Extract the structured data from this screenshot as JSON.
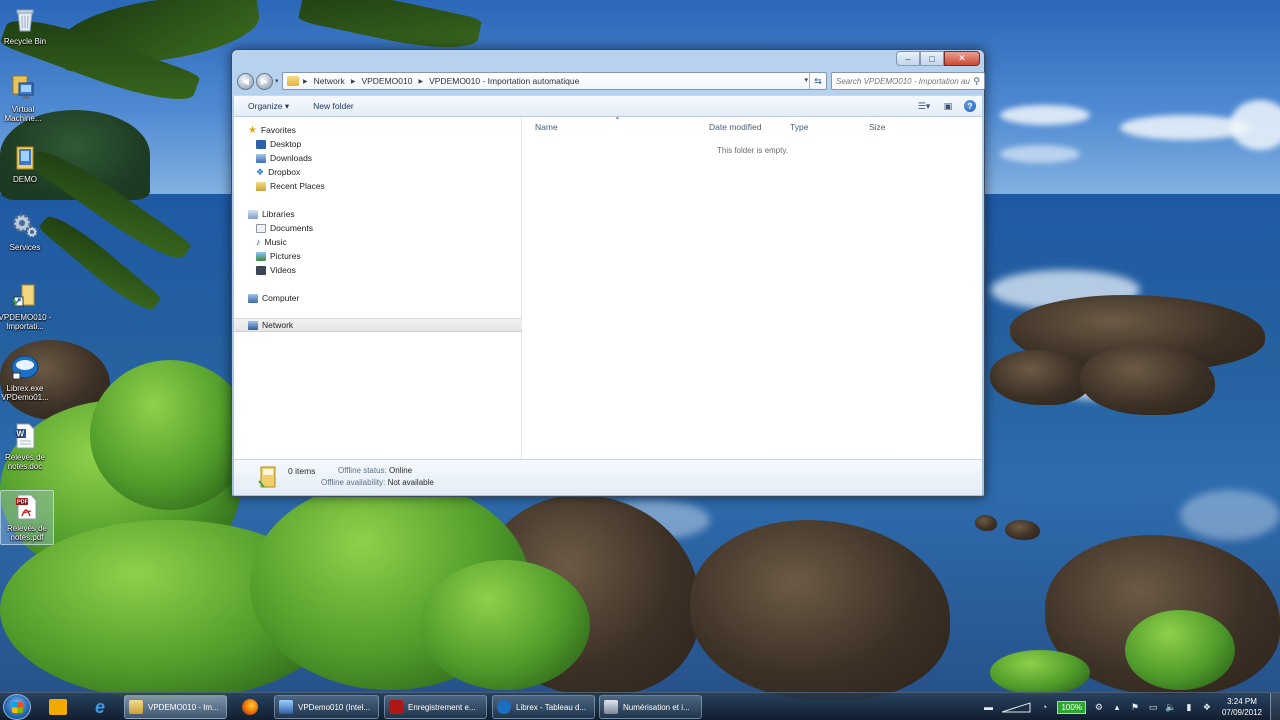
{
  "desktop": {
    "icons": [
      {
        "label": "Recycle Bin",
        "icon": "recycle-bin-icon"
      },
      {
        "label": "Virtual Machine...",
        "icon": "virtual-machine-icon"
      },
      {
        "label": "DEMO",
        "icon": "folder-icon"
      },
      {
        "label": "Services",
        "icon": "gear-icon"
      },
      {
        "label": "VPDEMO010 - Importati...",
        "icon": "folder-shortcut-icon"
      },
      {
        "label": "Librex.exe VPDemo01...",
        "icon": "librex-icon"
      },
      {
        "label": "Relevés de notes.doc",
        "icon": "word-document-icon"
      },
      {
        "label": "Relevés de notes.pdf",
        "icon": "pdf-document-icon"
      }
    ]
  },
  "window": {
    "controls": {
      "minimize": "‒",
      "maximize": "□",
      "close": "✕"
    },
    "address": {
      "crumbs": [
        "Network",
        "VPDEMO010",
        "VPDEMO010 - Importation automatique"
      ]
    },
    "search": {
      "placeholder": "Search VPDEMO010 - Importation aut..."
    },
    "toolbar": {
      "organize": "Organize ▾",
      "new_folder": "New folder"
    },
    "nav": {
      "favorites": "Favorites",
      "favorites_items": [
        "Desktop",
        "Downloads",
        "Dropbox",
        "Recent Places"
      ],
      "libraries": "Libraries",
      "libraries_items": [
        "Documents",
        "Music",
        "Pictures",
        "Videos"
      ],
      "computer": "Computer",
      "network": "Network"
    },
    "columns": [
      "Name",
      "Date modified",
      "Type",
      "Size"
    ],
    "empty_message": "This folder is empty.",
    "details": {
      "count": "0 items",
      "offline_status_label": "Offline status:",
      "offline_status_value": "Online",
      "offline_availability_label": "Offline availability:",
      "offline_availability_value": "Not available"
    }
  },
  "taskbar": {
    "tasks": [
      {
        "label": "VPDEMO010 - Im...",
        "icon": "folder-icon"
      },
      {
        "label": "VPDemo010 (Intel...",
        "icon": "virtual-machine-icon"
      },
      {
        "label": "Enregistrement e...",
        "icon": "recorder-icon"
      },
      {
        "label": "Librex - Tableau d...",
        "icon": "librex-icon"
      },
      {
        "label": "Numérisation et i...",
        "icon": "scanner-icon"
      }
    ],
    "battery": "100%",
    "time": "3:24 PM",
    "date": "07/09/2012"
  }
}
